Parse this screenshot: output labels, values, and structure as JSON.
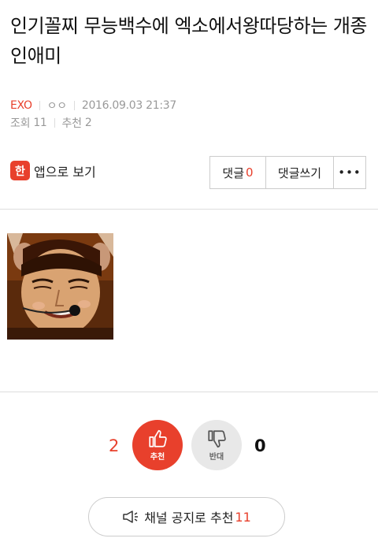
{
  "post": {
    "title": "인기꼴찌 무능백수에 엑소에서왕따당하는 개종인애미",
    "board": "EXO",
    "author": "ㅇㅇ",
    "datetime": "2016.09.03 21:37",
    "views_label": "조회",
    "views": "11",
    "recommend_label": "추천",
    "recommends": "2"
  },
  "toolbar": {
    "app_icon_text": "한",
    "app_view_label": "앱으로 보기",
    "comment_label": "댓글",
    "comment_count": "0",
    "write_comment_label": "댓글쓰기",
    "more_label": "•••"
  },
  "vote": {
    "up_count": "2",
    "up_label": "추천",
    "down_label": "반대",
    "down_count": "0"
  },
  "notice": {
    "label": "채널 공지로 추천",
    "count": "11"
  },
  "colors": {
    "accent": "#e8402c",
    "muted": "#999999",
    "border": "#cccccc"
  }
}
